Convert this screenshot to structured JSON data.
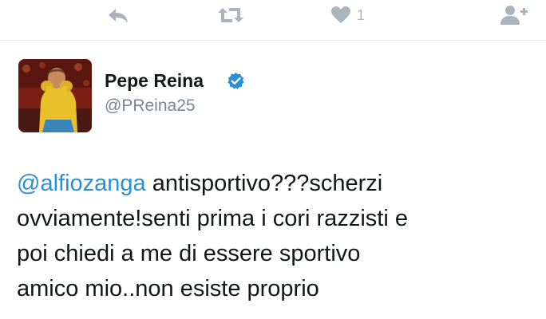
{
  "actions": {
    "reply_icon": "reply-icon",
    "retweet_icon": "retweet-icon",
    "like_icon": "heart-icon",
    "like_count": "1",
    "follow_icon": "follow-user-icon"
  },
  "tweet": {
    "user": {
      "name": "Pepe Reina",
      "handle": "@PReina25",
      "verified": true
    },
    "mention": "@alfiozanga",
    "lines": {
      "line1_rest": " antisportivo???scherzi",
      "line2": "ovviamente!senti prima i cori razzisti e",
      "line3": "poi chiedi a me di essere sportivo",
      "line4": "amico mio..non esiste proprio"
    }
  },
  "colors": {
    "link": "#2b8fd6",
    "verified": "#2b8fd6",
    "icon_gray": "#a9b4bd",
    "text": "#14171a",
    "secondary_text": "#7a8791"
  }
}
